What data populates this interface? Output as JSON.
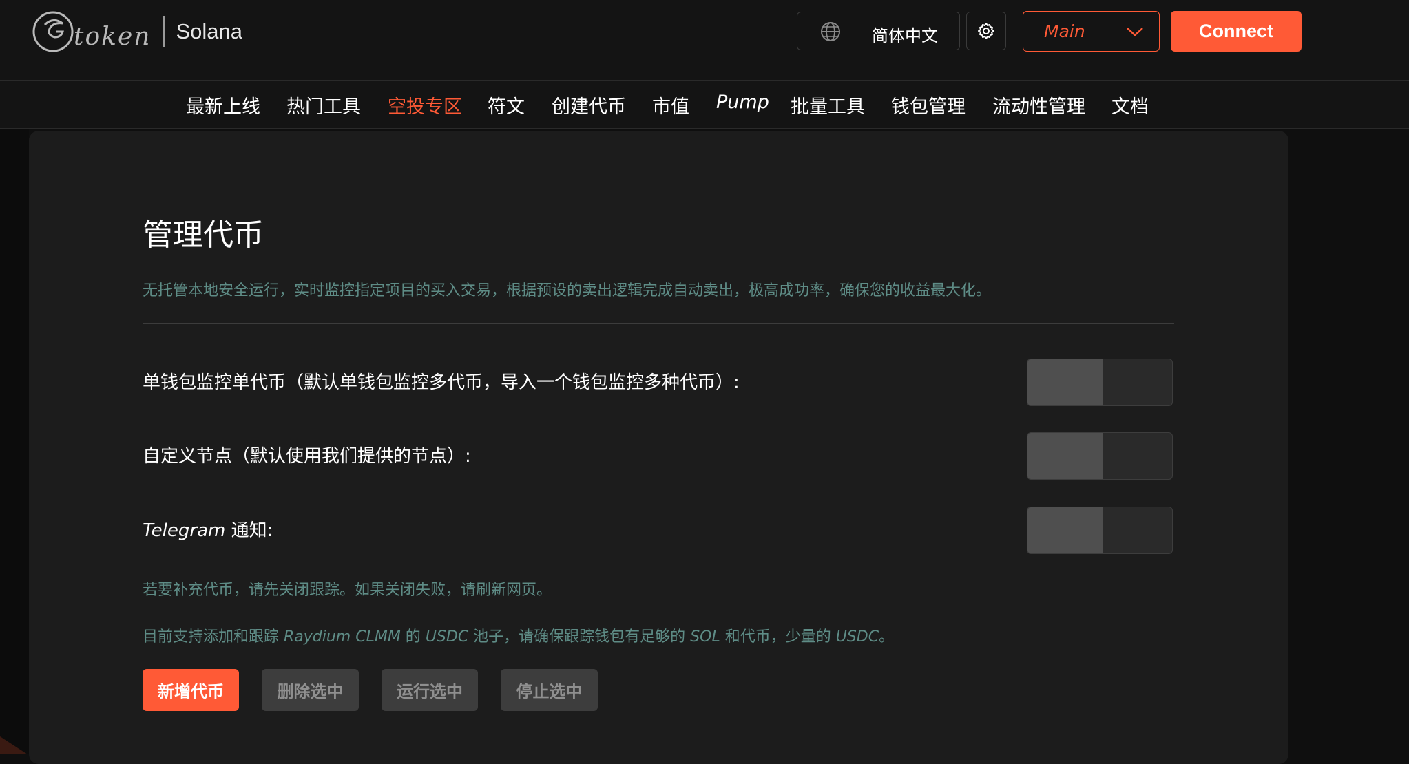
{
  "header": {
    "logo_word": "token",
    "chain": "Solana",
    "language": "简体中文",
    "network": "Main",
    "connect_label": "Connect"
  },
  "nav": {
    "items": [
      {
        "label": "最新上线"
      },
      {
        "label": "热门工具"
      },
      {
        "label": "空投专区",
        "active": true
      },
      {
        "label": "符文"
      },
      {
        "label": "创建代币"
      },
      {
        "label": "市值"
      },
      {
        "label": "Pump"
      },
      {
        "label": "批量工具"
      },
      {
        "label": "钱包管理"
      },
      {
        "label": "流动性管理"
      },
      {
        "label": "文档"
      }
    ]
  },
  "main": {
    "title": "管理代币",
    "description": "无托管本地安全运行，实时监控指定项目的买入交易，根据预设的卖出逻辑完成自动卖出，极高成功率，确保您的收益最大化。",
    "settings": [
      {
        "label": "单钱包监控单代币（默认单钱包监控多代币，导入一个钱包监控多种代币）:",
        "enabled": false
      },
      {
        "label": "自定义节点（默认使用我们提供的节点）:",
        "enabled": false
      },
      {
        "label_italic": "Telegram",
        "label": " 通知:",
        "enabled": false
      }
    ],
    "notes": {
      "note1": "若要补充代币，请先关闭跟踪。如果关闭失败，请刷新网页。",
      "note2_parts": [
        "目前支持添加和跟踪 ",
        "Raydium CLMM",
        " 的 ",
        "USDC",
        " 池子，请确保跟踪钱包有足够的 ",
        "SOL",
        " 和代币，少量的 ",
        "USDC",
        "。"
      ]
    },
    "actions": {
      "add": "新增代币",
      "delete": "删除选中",
      "run": "运行选中",
      "stop": "停止选中"
    }
  },
  "colors": {
    "accent": "#ff5a36",
    "muted_teal": "#5e8c86",
    "panel": "#1c1c1c"
  }
}
